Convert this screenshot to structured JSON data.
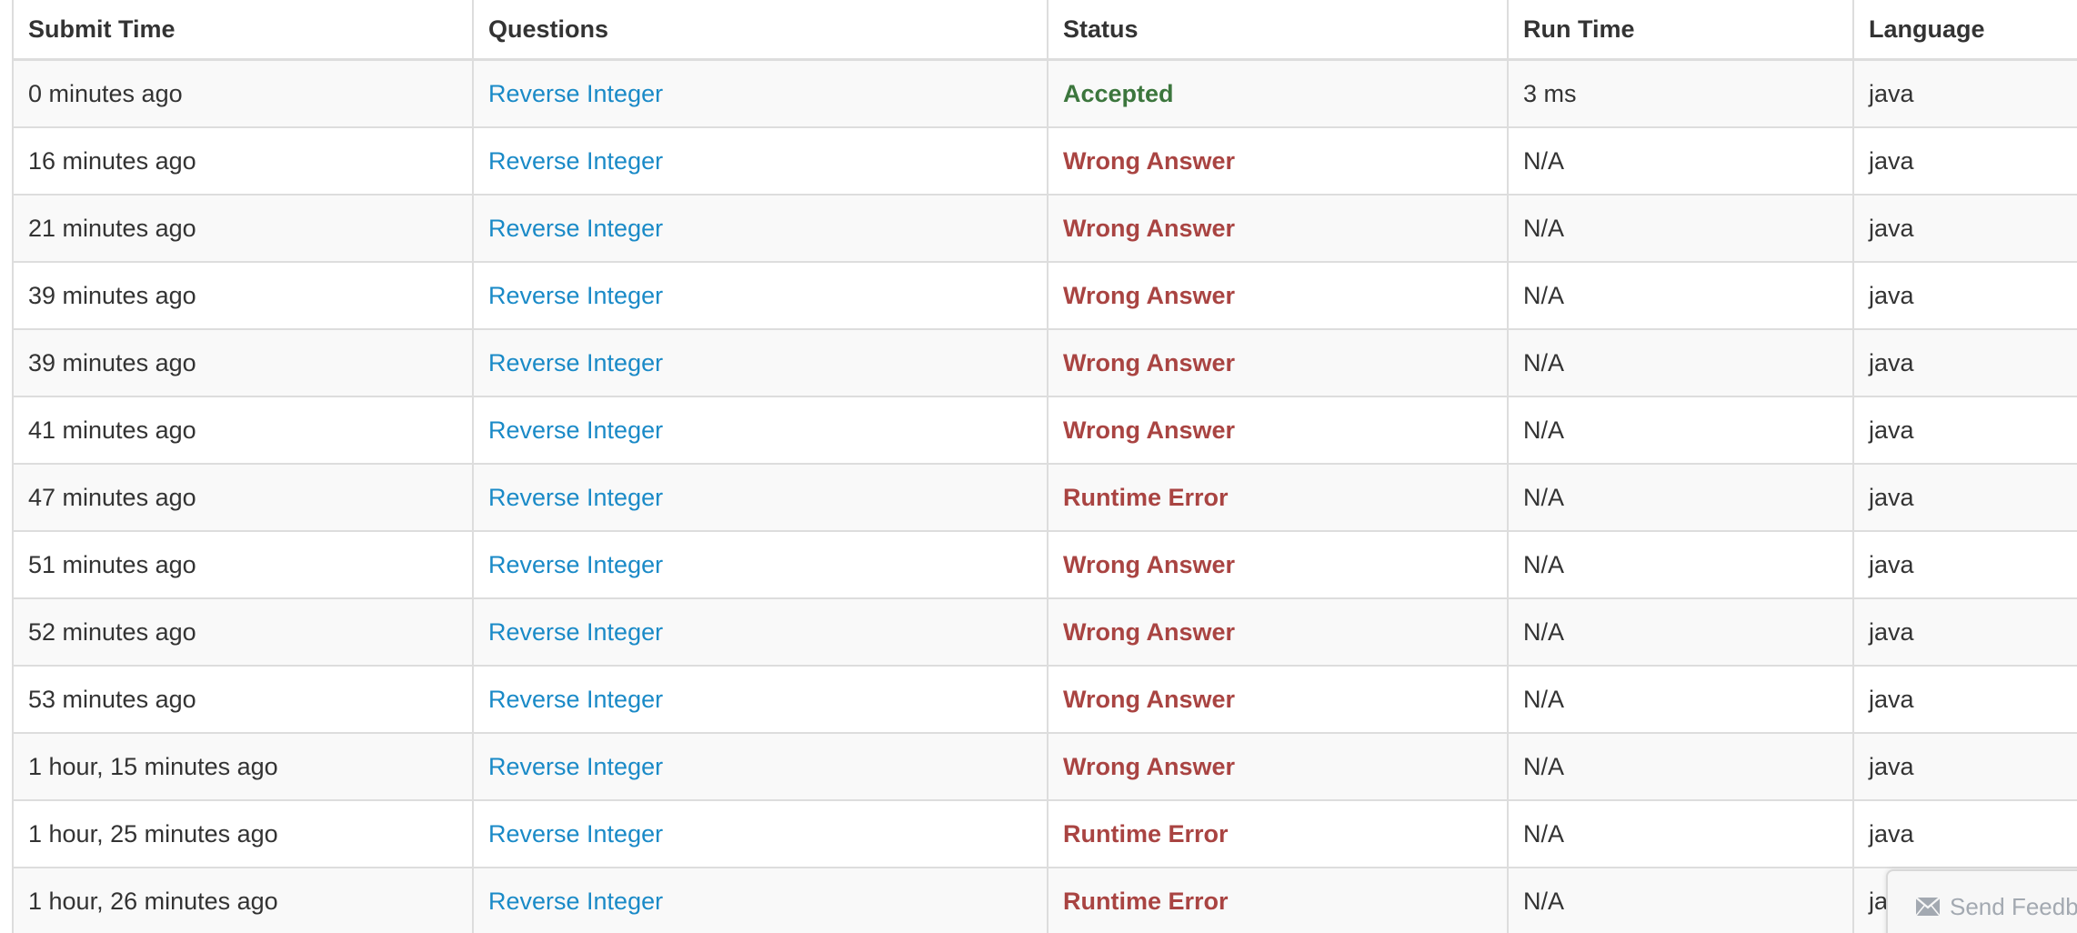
{
  "table": {
    "headers": [
      "Submit Time",
      "Questions",
      "Status",
      "Run Time",
      "Language"
    ],
    "rows": [
      {
        "time": "0 minutes ago",
        "question": "Reverse Integer",
        "status": "Accepted",
        "runtime": "3 ms",
        "language": "java"
      },
      {
        "time": "16 minutes ago",
        "question": "Reverse Integer",
        "status": "Wrong Answer",
        "runtime": "N/A",
        "language": "java"
      },
      {
        "time": "21 minutes ago",
        "question": "Reverse Integer",
        "status": "Wrong Answer",
        "runtime": "N/A",
        "language": "java"
      },
      {
        "time": "39 minutes ago",
        "question": "Reverse Integer",
        "status": "Wrong Answer",
        "runtime": "N/A",
        "language": "java"
      },
      {
        "time": "39 minutes ago",
        "question": "Reverse Integer",
        "status": "Wrong Answer",
        "runtime": "N/A",
        "language": "java"
      },
      {
        "time": "41 minutes ago",
        "question": "Reverse Integer",
        "status": "Wrong Answer",
        "runtime": "N/A",
        "language": "java"
      },
      {
        "time": "47 minutes ago",
        "question": "Reverse Integer",
        "status": "Runtime Error",
        "runtime": "N/A",
        "language": "java"
      },
      {
        "time": "51 minutes ago",
        "question": "Reverse Integer",
        "status": "Wrong Answer",
        "runtime": "N/A",
        "language": "java"
      },
      {
        "time": "52 minutes ago",
        "question": "Reverse Integer",
        "status": "Wrong Answer",
        "runtime": "N/A",
        "language": "java"
      },
      {
        "time": "53 minutes ago",
        "question": "Reverse Integer",
        "status": "Wrong Answer",
        "runtime": "N/A",
        "language": "java"
      },
      {
        "time": "1 hour, 15 minutes ago",
        "question": "Reverse Integer",
        "status": "Wrong Answer",
        "runtime": "N/A",
        "language": "java"
      },
      {
        "time": "1 hour, 25 minutes ago",
        "question": "Reverse Integer",
        "status": "Runtime Error",
        "runtime": "N/A",
        "language": "java"
      },
      {
        "time": "1 hour, 26 minutes ago",
        "question": "Reverse Integer",
        "status": "Runtime Error",
        "runtime": "N/A",
        "language": "java"
      }
    ]
  },
  "feedback": {
    "label": "Send Feedback",
    "icon": "envelope-icon"
  },
  "colors": {
    "link": "#1a8ac7",
    "accepted": "#3c763d",
    "error": "#a94442",
    "text": "#333333",
    "border": "#dddddd",
    "stripe": "#f9f9f9"
  }
}
